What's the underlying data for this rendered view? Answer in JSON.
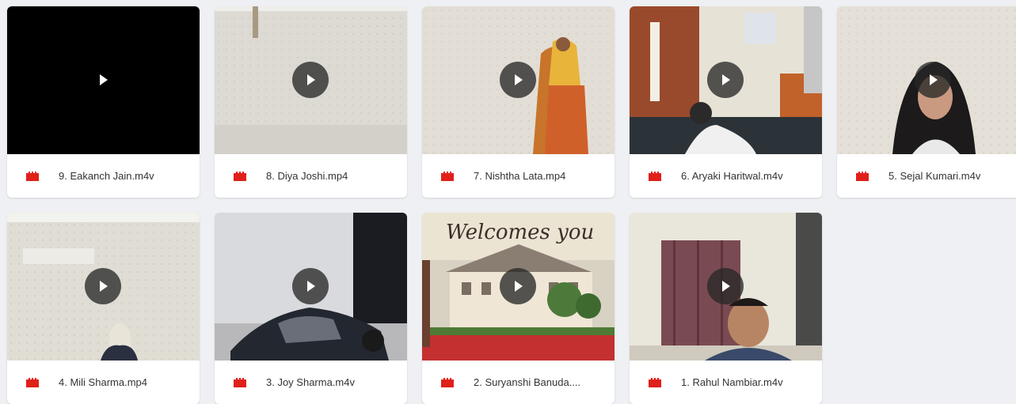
{
  "colors": {
    "accent": "#e0201b",
    "play_overlay": "#282828"
  },
  "videos": [
    {
      "name": "9. Eakanch Jain.m4v"
    },
    {
      "name": "8. Diya Joshi.mp4"
    },
    {
      "name": "7. Nishtha Lata.mp4"
    },
    {
      "name": "6. Aryaki Haritwal.m4v"
    },
    {
      "name": "5. Sejal Kumari.m4v"
    },
    {
      "name": "4. Mili Sharma.mp4"
    },
    {
      "name": "3. Joy Sharma.m4v"
    },
    {
      "name": "2. Suryanshi Banuda...."
    },
    {
      "name": "1. Rahul Nambiar.m4v"
    }
  ],
  "thumbnail_overlay_text": "Welcomes you",
  "icons": {
    "play": "play-icon",
    "file": "video-file-icon"
  }
}
